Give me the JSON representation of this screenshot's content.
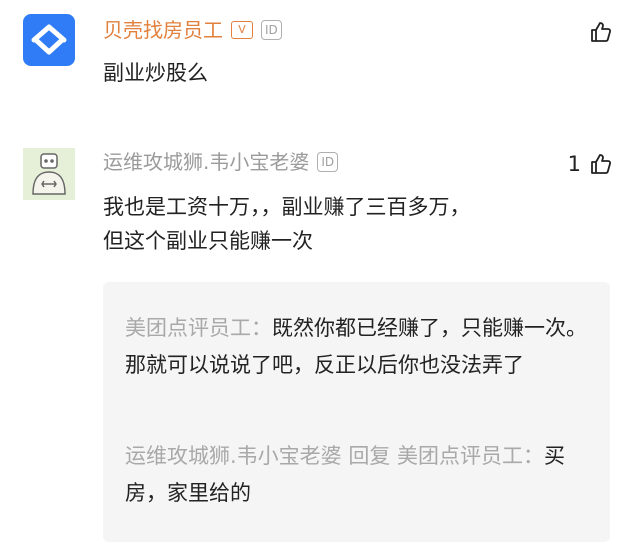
{
  "comment1": {
    "author": "贝壳找房员工",
    "badge": "V",
    "id_tag": "ID",
    "text": "副业炒股么",
    "likes": ""
  },
  "comment2": {
    "author": "运维攻城狮.韦小宝老婆",
    "id_tag": "ID",
    "text_line1": "我也是工资十万，，副业赚了三百多万，",
    "text_line2": "但这个副业只能赚一次",
    "likes": "1"
  },
  "replies": [
    {
      "author": "美团点评员工：",
      "text": "既然你都已经赚了，只能赚一次。那就可以说说了吧，反正以后你也没法弄了"
    },
    {
      "author": "运维攻城狮.韦小宝老婆 回复 美团点评员工：",
      "text": "买房，家里给的"
    }
  ]
}
